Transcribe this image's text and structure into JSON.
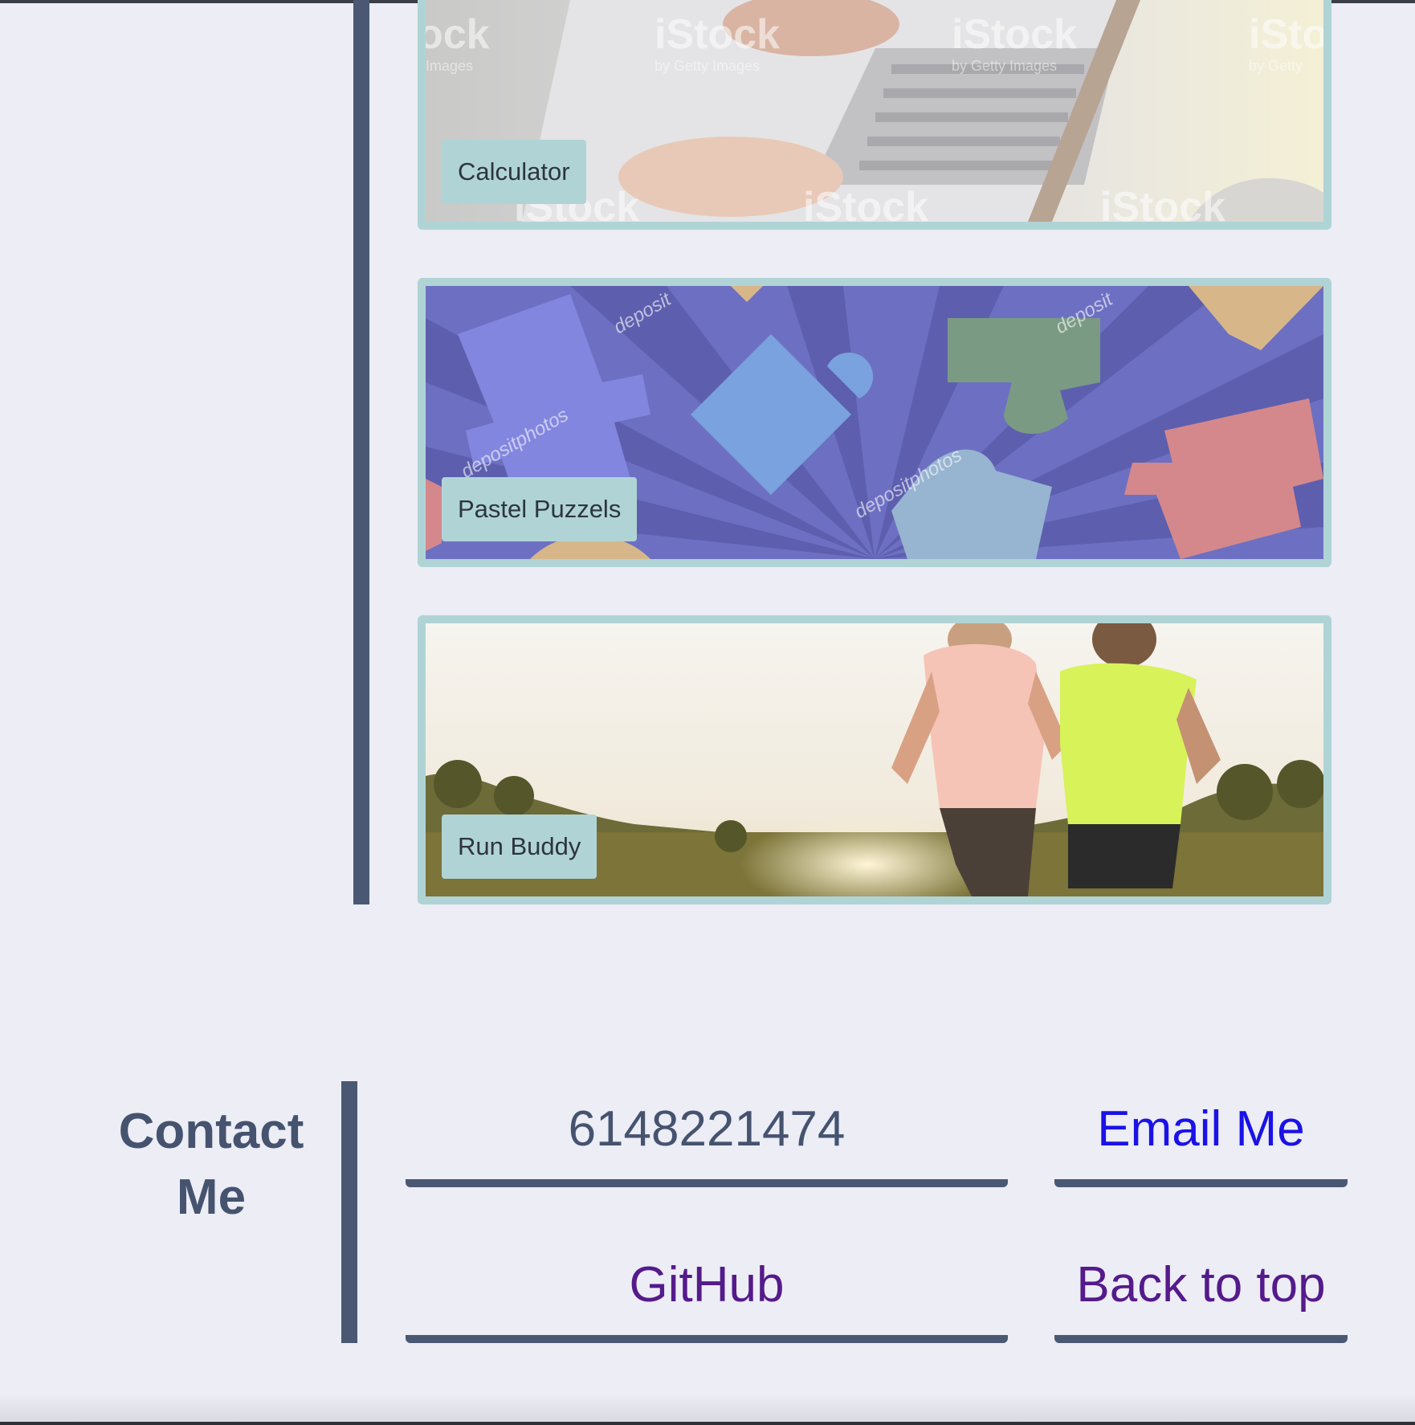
{
  "projects": [
    {
      "title": "Calculator"
    },
    {
      "title": "Pastel Puzzels"
    },
    {
      "title": "Run Buddy"
    }
  ],
  "contact": {
    "heading": "Contact Me",
    "phone": "6148221474",
    "email_label": "Email Me",
    "github_label": "GitHub",
    "back_to_top_label": "Back to top"
  },
  "colors": {
    "page_background": "#ecedf5",
    "accent_rule": "#4a5873",
    "card_border": "#b0d4d6",
    "link_unvisited": "#1a12e6",
    "link_visited": "#551a8b"
  }
}
